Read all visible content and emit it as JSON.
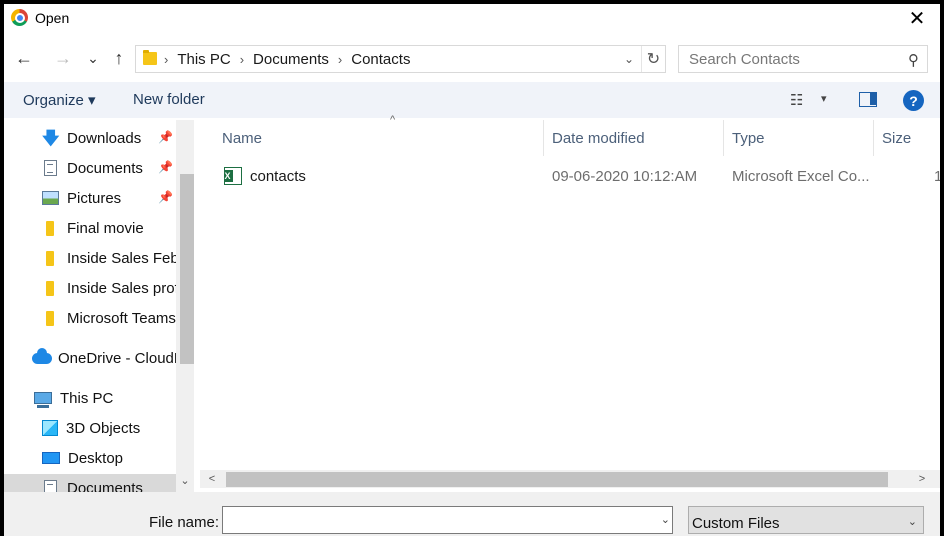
{
  "window": {
    "title": "Open",
    "close_glyph": "✕"
  },
  "nav": {
    "back": "←",
    "forward": "→",
    "recent": "⌄",
    "up": "↑"
  },
  "address": {
    "crumbs": [
      "This PC",
      "Documents",
      "Contacts"
    ],
    "separator": "›",
    "dropdown_glyph": "⌄",
    "refresh_glyph": "↻"
  },
  "search": {
    "placeholder": "Search Contacts",
    "icon_glyph": "⚲"
  },
  "toolbar": {
    "organize_label": "Organize ▾",
    "new_folder_label": "New folder",
    "view_glyph": "☷",
    "view_dd_glyph": "▾",
    "help_glyph": "?"
  },
  "sidebar": {
    "items": [
      {
        "label": "Downloads",
        "icon": "download-arrow-icon",
        "pinned": true
      },
      {
        "label": "Documents",
        "icon": "document-icon",
        "pinned": true
      },
      {
        "label": "Pictures",
        "icon": "pictures-icon",
        "pinned": true
      },
      {
        "label": "Final movie",
        "icon": "folder-icon",
        "pinned": false
      },
      {
        "label": "Inside Sales Feb",
        "icon": "folder-icon",
        "pinned": false
      },
      {
        "label": "Inside Sales prof",
        "icon": "folder-icon",
        "pinned": false
      },
      {
        "label": "Microsoft Teams",
        "icon": "folder-icon",
        "pinned": false
      },
      {
        "label": "OneDrive - CloudF",
        "icon": "onedrive-cloud-icon",
        "pinned": false
      },
      {
        "label": "This PC",
        "icon": "this-pc-icon",
        "pinned": false
      },
      {
        "label": "3D Objects",
        "icon": "3d-objects-icon",
        "pinned": false
      },
      {
        "label": "Desktop",
        "icon": "desktop-icon",
        "pinned": false
      },
      {
        "label": "Documents",
        "icon": "document-icon",
        "pinned": false,
        "selected": true
      }
    ],
    "pin_glyph": "📌",
    "scroll_down_glyph": "⌄"
  },
  "columns": [
    "Name",
    "Date modified",
    "Type",
    "Size"
  ],
  "sort_glyph": "^",
  "files": [
    {
      "name": "contacts",
      "date": "09-06-2020 10:12:AM",
      "type": "Microsoft Excel Co...",
      "size": "1"
    }
  ],
  "hscroll": {
    "left_glyph": "<",
    "right_glyph": ">"
  },
  "bottom": {
    "file_name_label": "File name:",
    "file_name_value": "",
    "file_name_dd_glyph": "⌄",
    "file_type_value": "Custom Files",
    "file_type_dd_glyph": "⌄"
  }
}
